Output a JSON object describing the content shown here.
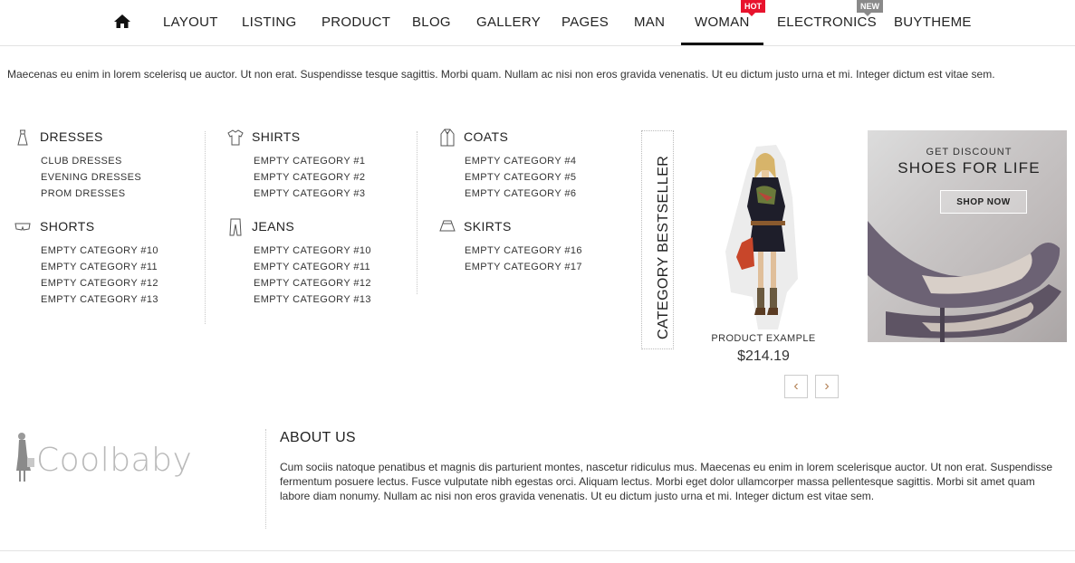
{
  "nav": {
    "home_icon": "home-icon",
    "items": [
      {
        "label": "LAYOUT"
      },
      {
        "label": "LISTING"
      },
      {
        "label": "PRODUCT"
      },
      {
        "label": "BLOG"
      },
      {
        "label": "GALLERY"
      },
      {
        "label": "PAGES"
      },
      {
        "label": "MAN"
      },
      {
        "label": "WOMAN",
        "badge": "HOT"
      },
      {
        "label": "ELECTRONICS",
        "badge": "NEW"
      },
      {
        "label": "BUYTHEME"
      }
    ],
    "active": "WOMAN"
  },
  "intro_text": "Maecenas eu enim in lorem scelerisq ue auctor. Ut non erat. Suspendisse tesque sagittis. Morbi quam. Nullam ac nisi non eros gravida venenatis. Ut eu dictum justo urna et mi. Integer dictum est vitae sem.",
  "categories": {
    "dresses": {
      "title": "DRESSES",
      "icon": "dress-icon",
      "links": [
        "CLUB DRESSES",
        "EVENING DRESSES",
        "PROM DRESSES"
      ]
    },
    "shorts": {
      "title": "SHORTS",
      "icon": "shorts-icon",
      "links": [
        "EMPTY CATEGORY #10",
        "EMPTY CATEGORY #11",
        "EMPTY CATEGORY #12",
        "EMPTY CATEGORY #13"
      ]
    },
    "shirts": {
      "title": "SHIRTS",
      "icon": "shirt-icon",
      "links": [
        "EMPTY CATEGORY #1",
        "EMPTY CATEGORY #2",
        "EMPTY CATEGORY #3"
      ]
    },
    "jeans": {
      "title": "JEANS",
      "icon": "jeans-icon",
      "links": [
        "EMPTY CATEGORY #10",
        "EMPTY CATEGORY #11",
        "EMPTY CATEGORY #12",
        "EMPTY CATEGORY #13"
      ]
    },
    "coats": {
      "title": "COATS",
      "icon": "coat-icon",
      "links": [
        "EMPTY CATEGORY #4",
        "EMPTY CATEGORY #5",
        "EMPTY CATEGORY #6"
      ]
    },
    "skirts": {
      "title": "SKIRTS",
      "icon": "skirt-icon",
      "links": [
        "EMPTY CATEGORY #16",
        "EMPTY CATEGORY #17"
      ]
    }
  },
  "bestseller": {
    "label": "CATEGORY BESTSELLER",
    "product_name": "PRODUCT EXAMPLE",
    "product_price": "$214.19",
    "prev_icon": "chevron-left-icon",
    "next_icon": "chevron-right-icon",
    "accent_color": "#b5845a"
  },
  "banner": {
    "subtitle": "GET DISCOUNT",
    "title": "SHOES FOR LIFE",
    "button": "SHOP NOW"
  },
  "footer": {
    "logo_text": "Coolbaby",
    "about_title": "ABOUT US",
    "about_text": "Cum sociis natoque penatibus et magnis dis parturient montes, nascetur ridiculus mus. Maecenas eu enim in lorem scelerisque auctor. Ut non erat. Suspendisse fermentum posuere lectus. Fusce vulputate nibh egestas orci. Aliquam lectus. Morbi eget dolor ullamcorper massa pellentesque sagittis. Morbi sit amet quam labore diam nonumy. Nullam ac nisi non eros gravida venenatis. Ut eu dictum justo urna et mi. Integer dictum est vitae sem."
  },
  "colors": {
    "hot_badge": "#e8132d",
    "new_badge": "#8a8a8a"
  }
}
